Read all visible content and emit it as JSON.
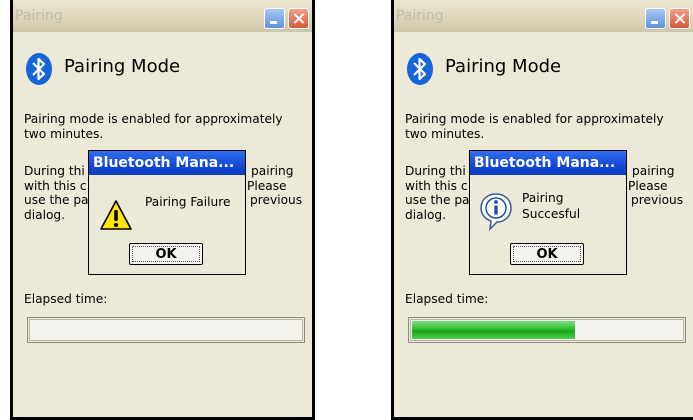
{
  "screens": [
    {
      "window_title": "Pairing",
      "heading": "Pairing Mode",
      "paragraph1": "Pairing mode is enabled for approximately two minutes.",
      "paragraph2_left": "During thi",
      "paragraph2_left_lines": [
        "During thi",
        "with this c",
        "use the pa",
        "dialog."
      ],
      "paragraph2_right_lines": [
        "pairing",
        "Please",
        "previous"
      ],
      "elapsed_label": "Elapsed time:",
      "progress_fraction": 0.0,
      "dialog": {
        "title": "Bluetooth Mana...",
        "icon": "warning-icon",
        "message_lines": [
          "Pairing Failure"
        ],
        "ok_label": "OK"
      }
    },
    {
      "window_title": "Pairing",
      "heading": "Pairing Mode",
      "paragraph1": "Pairing mode is enabled for approximately two minutes.",
      "paragraph2_left_lines": [
        "During thi",
        "with this c",
        "use the pa",
        "dialog."
      ],
      "paragraph2_right_lines": [
        "pairing",
        "Please",
        "previous"
      ],
      "elapsed_label": "Elapsed time:",
      "progress_fraction": 0.6,
      "dialog": {
        "title": "Bluetooth Mana...",
        "icon": "info-icon",
        "message_lines": [
          "Pairing",
          "Succesful"
        ],
        "ok_label": "OK"
      }
    }
  ],
  "colors": {
    "titlebar_active": "#1548d4",
    "progress_green": "#2dbd2d",
    "bluetooth_blue": "#1564d8",
    "warning_yellow": "#ffe600"
  }
}
